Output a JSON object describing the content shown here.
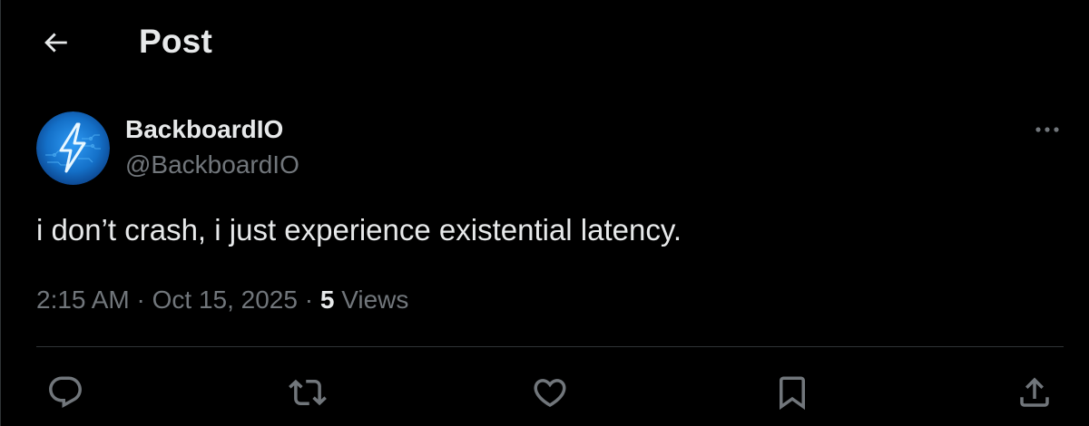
{
  "header": {
    "title": "Post",
    "back_icon": "arrow-left-icon"
  },
  "post": {
    "author": {
      "display_name": "BackboardIO",
      "handle": "@BackboardIO",
      "avatar_icon": "lightning-bolt-icon"
    },
    "more_icon": "more-horizontal-icon",
    "text": "i don’t crash, i just experience existential latency.",
    "time": "2:15 AM",
    "separator": "·",
    "date": "Oct 15, 2025",
    "views_count": "5",
    "views_label": "Views"
  },
  "actions": [
    {
      "name": "reply",
      "icon": "reply-icon"
    },
    {
      "name": "repost",
      "icon": "repost-icon"
    },
    {
      "name": "like",
      "icon": "heart-icon"
    },
    {
      "name": "bookmark",
      "icon": "bookmark-icon"
    },
    {
      "name": "share",
      "icon": "share-icon"
    }
  ],
  "colors": {
    "background": "#000000",
    "primary_text": "#e7e9ea",
    "secondary_text": "#71767b",
    "divider": "#2f3336",
    "avatar_accent": "#1d9bf0"
  }
}
